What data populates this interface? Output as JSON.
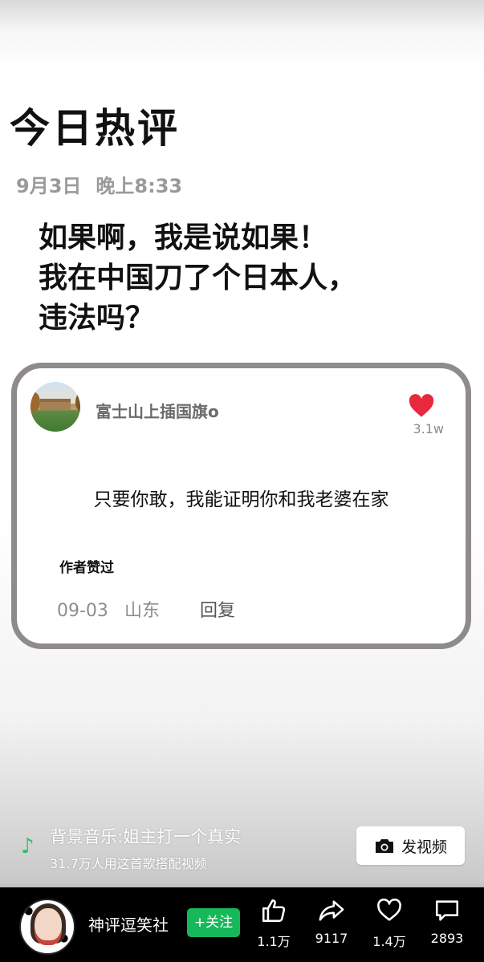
{
  "post": {
    "title": "今日热评",
    "date": "9月3日",
    "time": "晚上8:33",
    "headline_lines": [
      "如果啊，我是说如果！",
      "我在中国刀了个日本人，",
      "违法吗？"
    ]
  },
  "comment": {
    "username": "富士山上插国旗o",
    "like_count": "3.1w",
    "text": "只要你敢，我能证明你和我老婆在家",
    "author_liked": "作者赞过",
    "date": "09-03",
    "location": "山东",
    "reply_label": "回复"
  },
  "music": {
    "title": "背景音乐:姐主打一个真实",
    "usage": "31.7万人用这首歌搭配视频",
    "post_video_label": "发视频"
  },
  "bottom_bar": {
    "channel_name": "神评逗笑社",
    "follow_label": "+关注",
    "likes": "1.1万",
    "shares": "9117",
    "favorites": "1.4万",
    "comments": "2893"
  },
  "colors": {
    "follow_green": "#16b85a",
    "heart_red": "#e8283c",
    "card_border": "#8f8a8e",
    "music_icon_green": "#20c46a"
  }
}
